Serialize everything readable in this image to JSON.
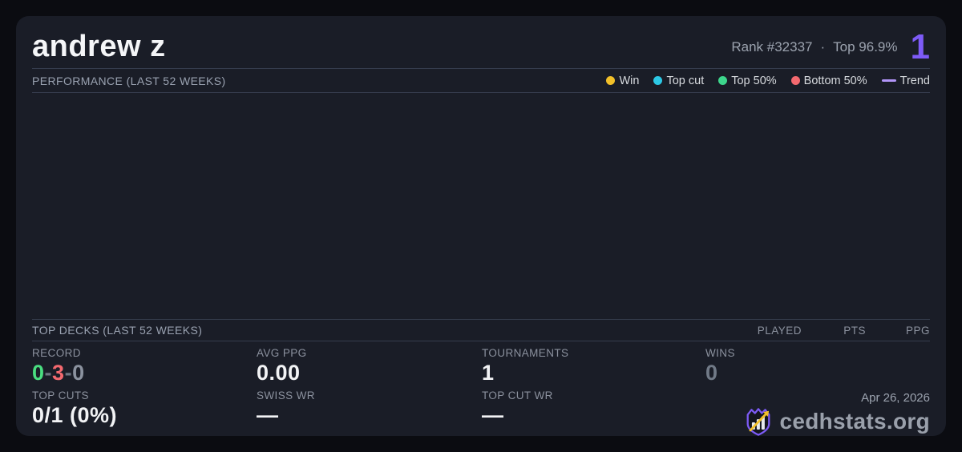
{
  "card": {
    "title": "andrew z",
    "rank_label": "Rank #32337",
    "rank_separator": "·",
    "top_percent_label": "Top 96.9%",
    "badge_number": "1"
  },
  "performance": {
    "heading": "PERFORMANCE (LAST 52 WEEKS)",
    "legend": [
      {
        "label": "Win",
        "color": "#f2c029",
        "swatch": "dot"
      },
      {
        "label": "Top cut",
        "color": "#2cc8e5",
        "swatch": "dot"
      },
      {
        "label": "Top 50%",
        "color": "#3dd68c",
        "swatch": "dot"
      },
      {
        "label": "Bottom 50%",
        "color": "#f4696f",
        "swatch": "dot"
      },
      {
        "label": "Trend",
        "color": "#b295f8",
        "swatch": "line"
      }
    ],
    "chart_empty": true
  },
  "top_decks": {
    "heading": "TOP DECKS (LAST 52 WEEKS)",
    "columns": [
      "PLAYED",
      "PTS",
      "PPG"
    ]
  },
  "stats": {
    "record": {
      "label": "RECORD",
      "wins": "0",
      "losses": "3",
      "draws": "0",
      "separator": "-"
    },
    "avg_ppg": {
      "label": "AVG PPG",
      "value": "0.00"
    },
    "tournaments": {
      "label": "TOURNAMENTS",
      "value": "1"
    },
    "wins": {
      "label": "WINS",
      "value": "0"
    },
    "top_cuts": {
      "label": "TOP CUTS",
      "value": "0/1 (0%)"
    },
    "swiss_wr": {
      "label": "SWISS WR",
      "value": "—"
    },
    "top_cut_wr": {
      "label": "TOP CUT WR",
      "value": "—"
    }
  },
  "footer": {
    "date": "Apr 26, 2026",
    "brand": "cedhstats.org",
    "logo": "shield-bar-chart-arrow-icon"
  },
  "colors": {
    "page_bg": "#0b0c11",
    "card_bg": "#1a1d27",
    "divider": "#363d4e",
    "accent_purple": "#7e5bf7",
    "record_win_green": "#4ade80",
    "record_loss_red": "#f4696f",
    "record_draw_gray": "#8b929f",
    "logo_purple": "#7d5bf6",
    "logo_gold": "#f2c029"
  }
}
